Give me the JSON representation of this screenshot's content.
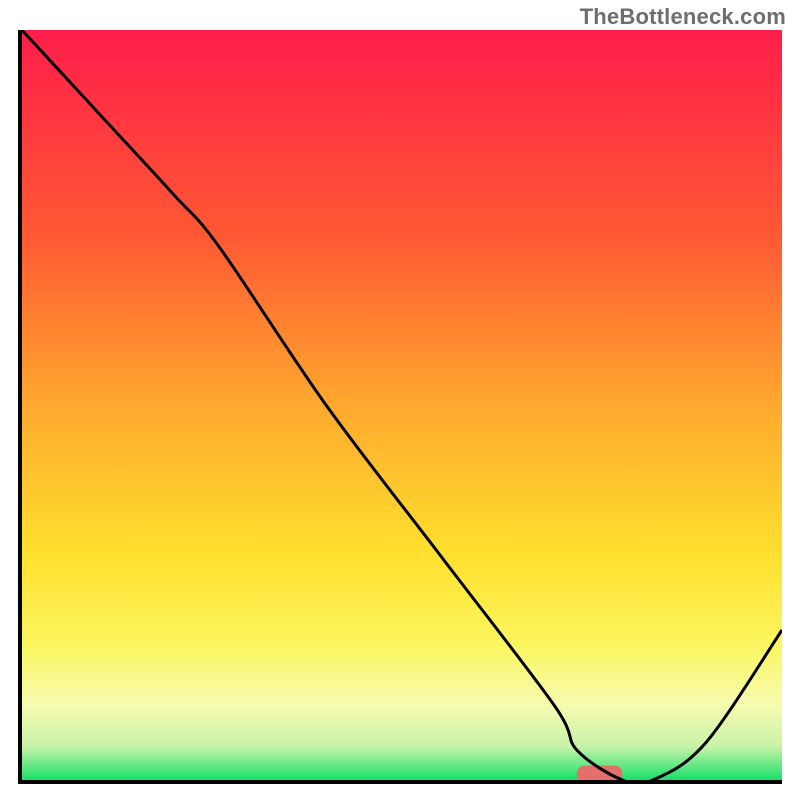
{
  "watermark": "TheBottleneck.com",
  "chart_data": {
    "type": "line",
    "title": "",
    "xlabel": "",
    "ylabel": "",
    "xlim": [
      0,
      100
    ],
    "ylim": [
      0,
      100
    ],
    "x": [
      0,
      10,
      20,
      26,
      40,
      55,
      70,
      73,
      79,
      83,
      90,
      100
    ],
    "values": [
      100,
      89,
      78,
      71,
      50,
      30,
      10,
      4,
      0,
      0,
      5,
      20
    ],
    "gradient_stops": [
      {
        "offset": 0.0,
        "color": "#ff1d4a"
      },
      {
        "offset": 0.28,
        "color": "#ff5a33"
      },
      {
        "offset": 0.5,
        "color": "#ffa92e"
      },
      {
        "offset": 0.7,
        "color": "#ffe02e"
      },
      {
        "offset": 0.82,
        "color": "#fbf65f"
      },
      {
        "offset": 0.9,
        "color": "#f6fbb0"
      },
      {
        "offset": 0.955,
        "color": "#c9f3a8"
      },
      {
        "offset": 1.0,
        "color": "#18e06a"
      }
    ],
    "marker": {
      "x_start": 73,
      "x_end": 79,
      "y": 0,
      "color": "#e36f6a"
    }
  }
}
